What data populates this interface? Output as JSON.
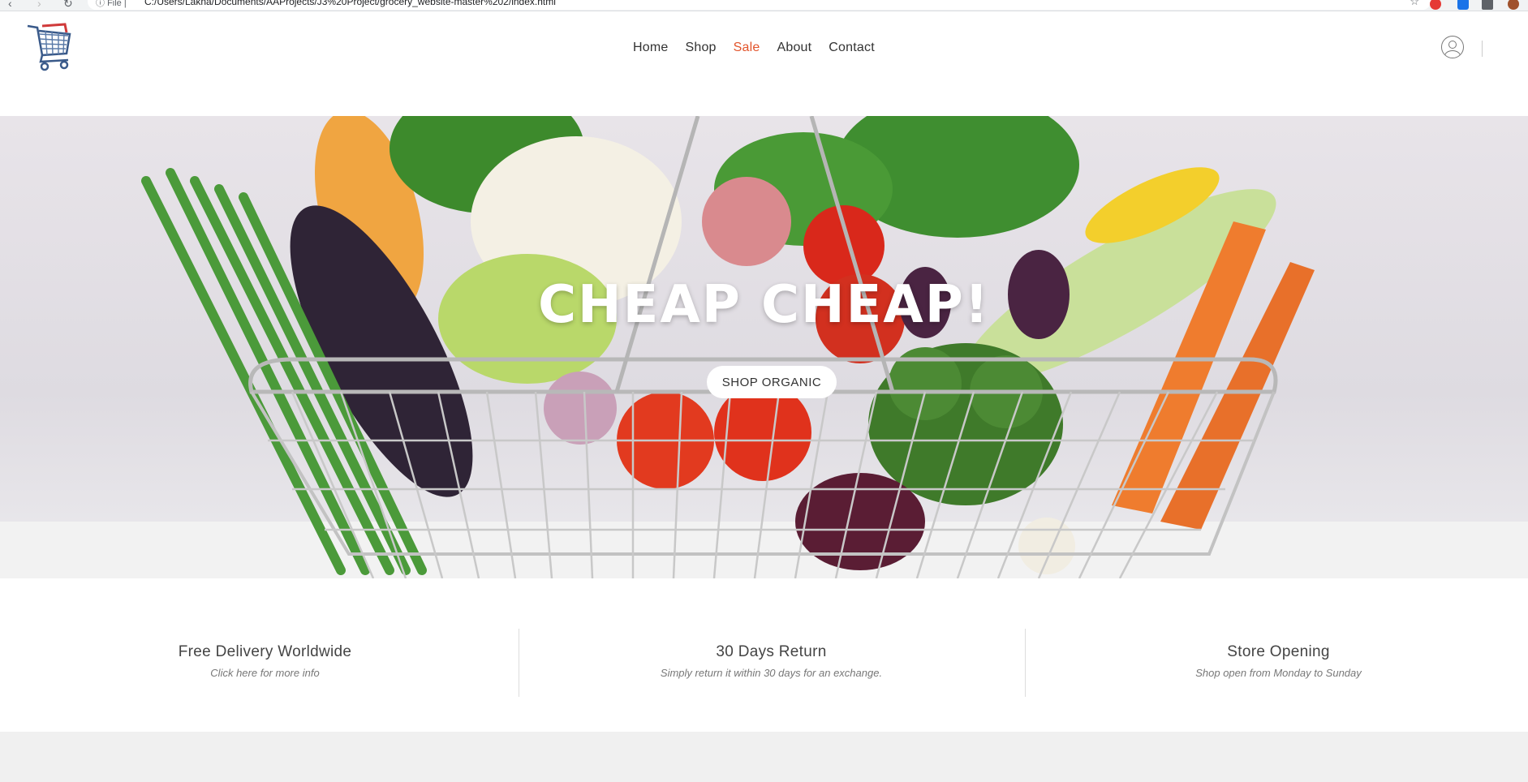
{
  "browser": {
    "url": "C:/Users/Lakna/Documents/AAProjects/J3%20Project/grocery_website-master%202/index.html",
    "file_label": "File"
  },
  "nav": {
    "items": [
      {
        "label": "Home",
        "active": false
      },
      {
        "label": "Shop",
        "active": false
      },
      {
        "label": "Sale",
        "active": true
      },
      {
        "label": "About",
        "active": false
      },
      {
        "label": "Contact",
        "active": false
      }
    ],
    "active_color": "#e2542b"
  },
  "hero": {
    "title": "CHEAP CHEAP!",
    "button_label": "SHOP ORGANIC"
  },
  "features": [
    {
      "title": "Free Delivery Worldwide",
      "subtitle": "Click here for more info"
    },
    {
      "title": "30 Days Return",
      "subtitle": "Simply return it within 30 days for an exchange."
    },
    {
      "title": "Store Opening",
      "subtitle": "Shop open from Monday to Sunday"
    }
  ],
  "icons": {
    "logo": "shopping-cart-logo",
    "user": "user-account-icon"
  }
}
